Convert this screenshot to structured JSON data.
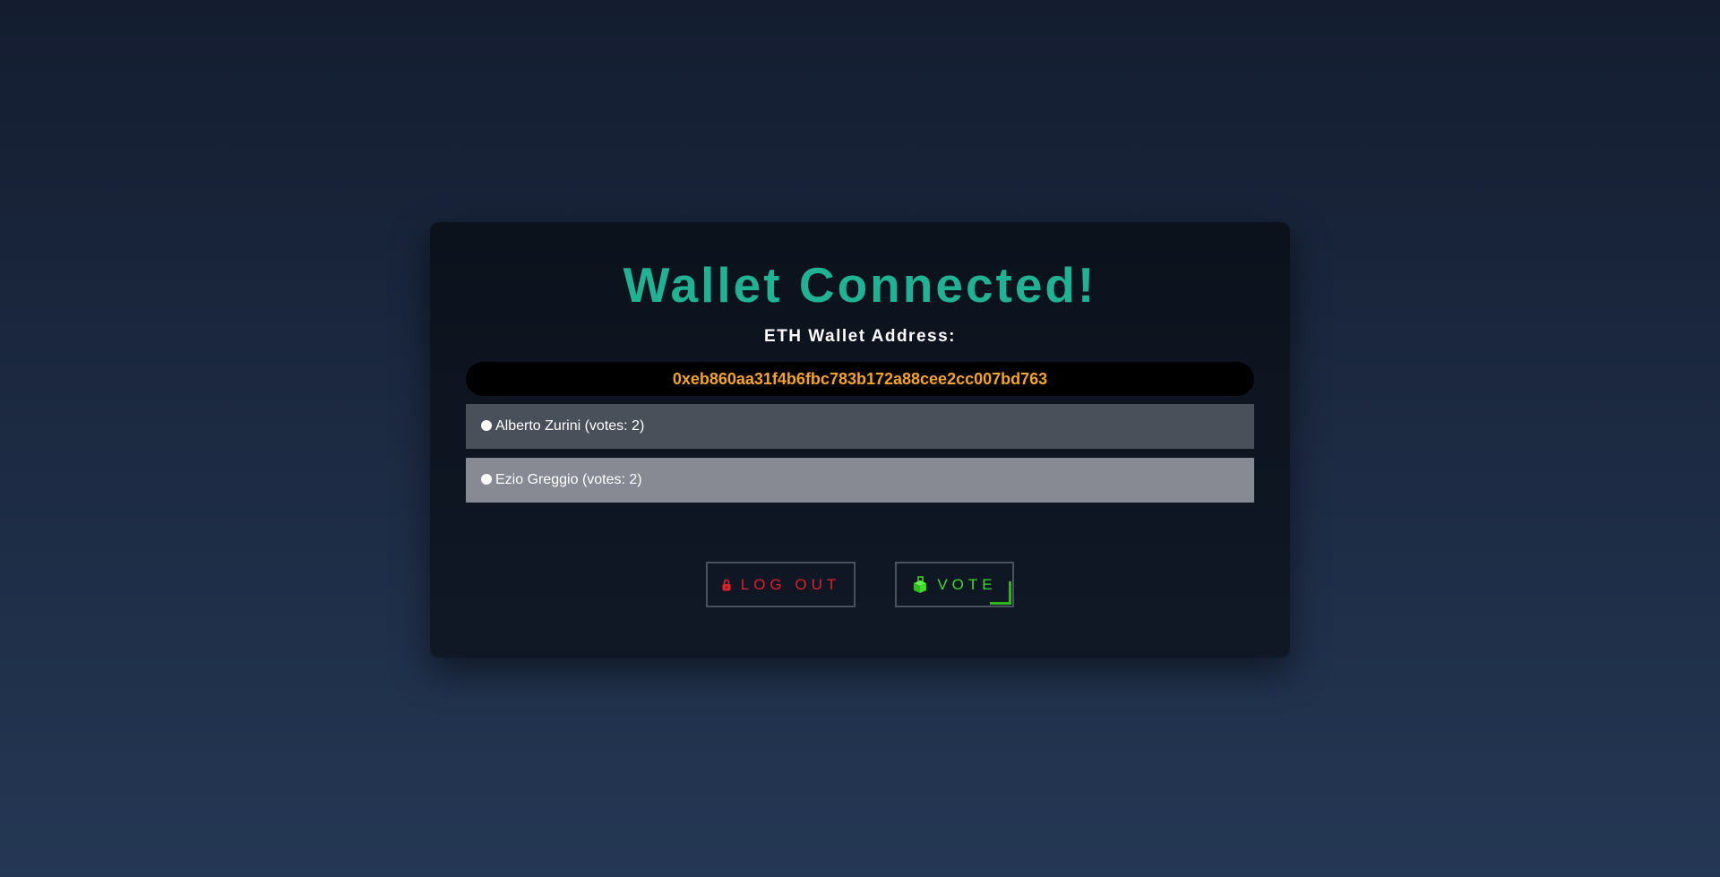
{
  "card": {
    "title": "Wallet Connected!",
    "address_label": "ETH Wallet Address:",
    "address": "0xeb860aa31f4b6fbc783b172a88cee2cc007bd763"
  },
  "candidates": [
    {
      "label": "Alberto Zurini (votes: 2)"
    },
    {
      "label": "Ezio Greggio (votes: 2)"
    }
  ],
  "buttons": {
    "logout": {
      "label": "LOG OUT",
      "icon": "lock-icon"
    },
    "vote": {
      "label": "VOTE",
      "icon": "ballot-box-icon"
    }
  },
  "colors": {
    "title": "#1fb394",
    "address": "#f5a524",
    "logout": "#e0202a",
    "vote": "#3ddc26"
  }
}
